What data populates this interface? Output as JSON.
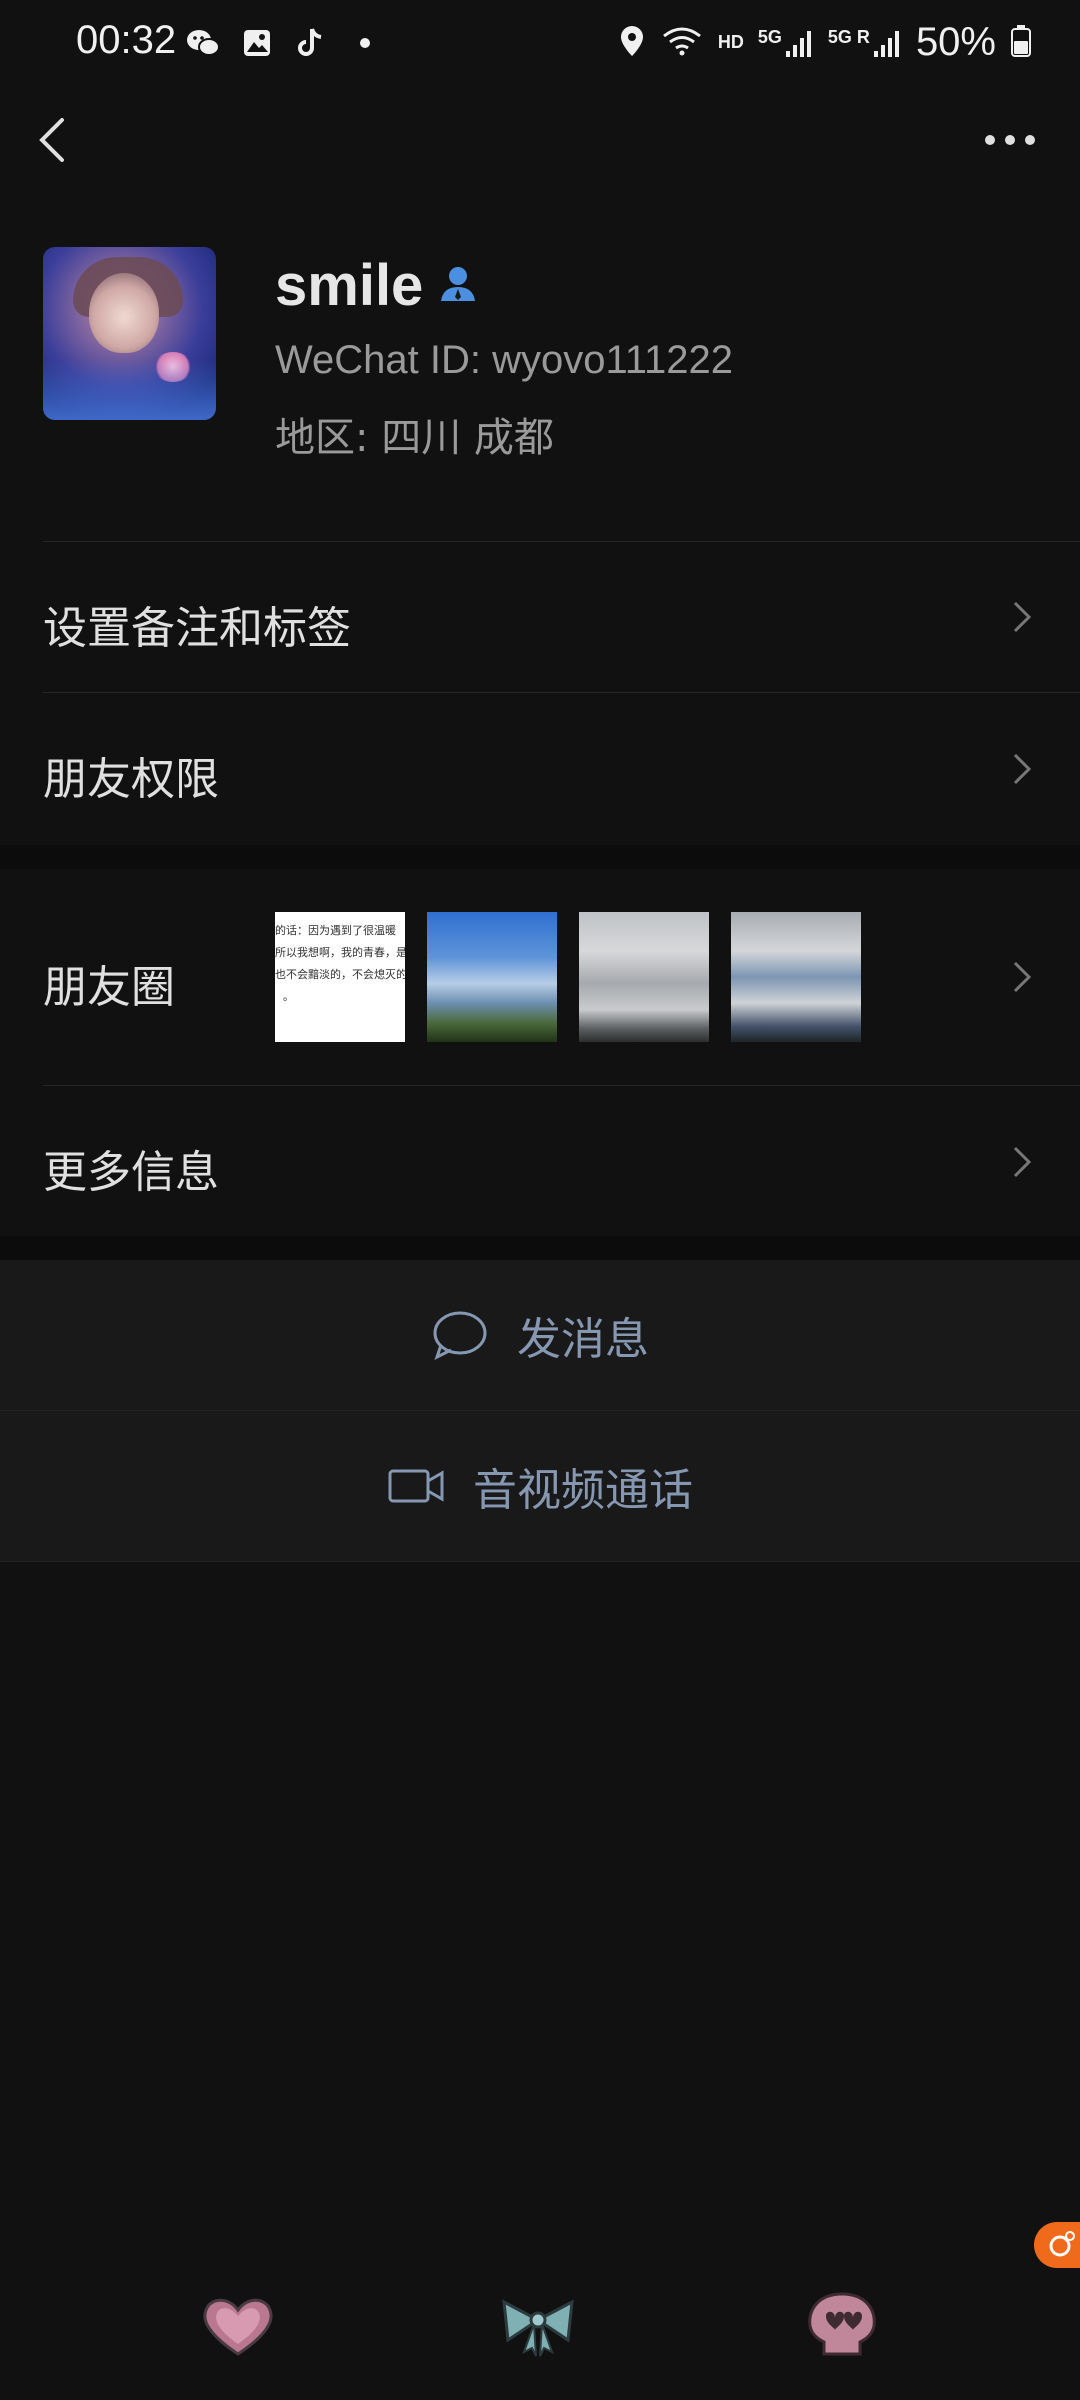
{
  "status_bar": {
    "time": "00:32",
    "battery_percent": "50%",
    "network_hd": "HD",
    "network_5g": "5G",
    "network_5gr": "5G R",
    "left_icons": [
      "wechat-icon",
      "gallery-icon",
      "tiktok-icon",
      "dot-icon"
    ],
    "right_icons": [
      "location-icon",
      "wifi-icon",
      "signal-icon",
      "battery-icon"
    ]
  },
  "header": {
    "back_icon": "chevron-left-icon",
    "more_icon": "more-dots-icon"
  },
  "profile": {
    "name": "smile",
    "badge_icon": "contact-person-icon",
    "wechat_id": "WeChat ID:  wyovo111222",
    "region": "地区:  四川  成都"
  },
  "rows": {
    "remark_label": "设置备注和标签",
    "permissions_label": "朋友权限",
    "moments_label": "朋友圈",
    "more_info_label": "更多信息"
  },
  "moments_thumbs": {
    "text_lines": [
      "的话：因为遇到了很温暖",
      "所以我想啊，我的青春，是",
      "也不会黯淡的，不会熄灭的",
      "。"
    ]
  },
  "actions": {
    "message_label": "发消息",
    "call_label": "音视频通话"
  },
  "colors": {
    "background": "#111111",
    "row_background": "#191919",
    "action_text": "#8597b1",
    "accent_float": "#f06a1b",
    "badge_blue": "#4a8fe0"
  }
}
